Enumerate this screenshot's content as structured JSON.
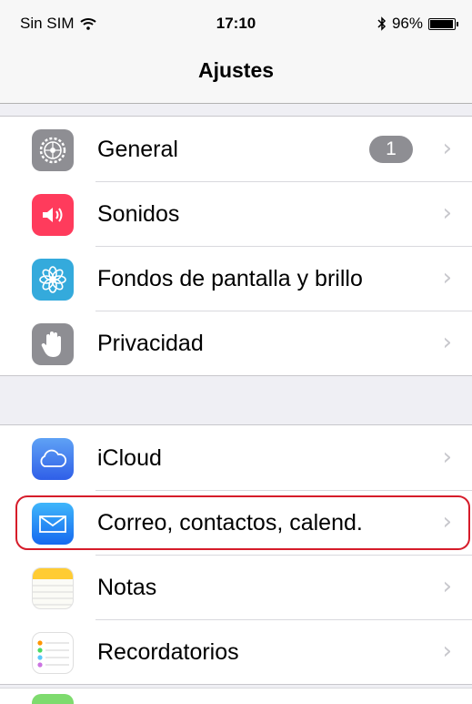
{
  "status": {
    "carrier": "Sin SIM",
    "time": "17:10",
    "battery_percent": "96%",
    "battery_level": 0.96
  },
  "nav": {
    "title": "Ajustes"
  },
  "groups": [
    {
      "rows": [
        {
          "label": "General",
          "icon": "gear-icon",
          "icon_color": "#8e8e93",
          "badge": "1"
        },
        {
          "label": "Sonidos",
          "icon": "speaker-icon",
          "icon_color": "#ff3b5c"
        },
        {
          "label": "Fondos de pantalla y brillo",
          "icon": "flower-icon",
          "icon_color": "#34aadc"
        },
        {
          "label": "Privacidad",
          "icon": "hand-icon",
          "icon_color": "#8e8e93"
        }
      ]
    },
    {
      "rows": [
        {
          "label": "iCloud",
          "icon": "cloud-icon",
          "icon_color": "#3e7bf1"
        },
        {
          "label": "Correo, contactos, calend.",
          "icon": "mail-icon",
          "icon_color": "#1d8cf3",
          "highlighted": true
        },
        {
          "label": "Notas",
          "icon": "notes-icon",
          "icon_color": "#ffcc33"
        },
        {
          "label": "Recordatorios",
          "icon": "reminders-icon",
          "icon_color": "#ffffff"
        }
      ]
    }
  ],
  "highlight_color": "#d61c2a"
}
